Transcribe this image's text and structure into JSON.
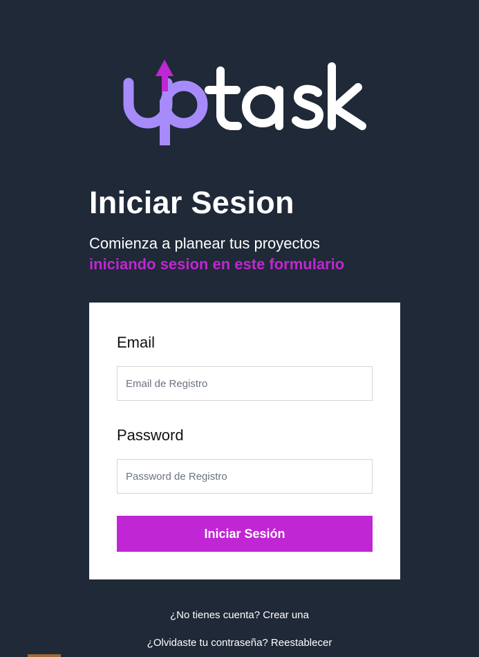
{
  "brand": {
    "logo_text": "uptask",
    "primary_color": "#a78bfa",
    "arrow_color": "#c026d3",
    "text_color": "#ffffff"
  },
  "page": {
    "title": "Iniciar Sesion",
    "subtitle": "Comienza a planear tus proyectos",
    "subtitle_accent": "iniciando sesion en este formulario",
    "background_color": "#1f2937",
    "accent_color": "#c026d3"
  },
  "form": {
    "email_label": "Email",
    "email_placeholder": "Email de Registro",
    "email_value": "",
    "password_label": "Password",
    "password_placeholder": "Password de Registro",
    "password_value": "",
    "submit_label": "Iniciar Sesión"
  },
  "links": {
    "register": "¿No tienes cuenta? Crear una",
    "reset": "¿Olvidaste tu contraseña? Reestablecer"
  }
}
